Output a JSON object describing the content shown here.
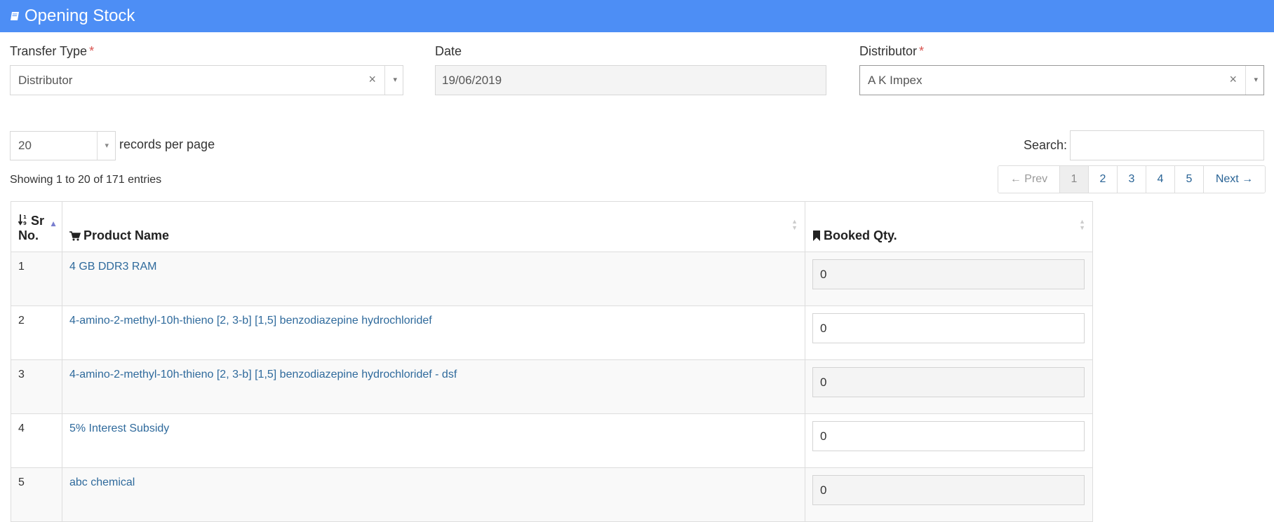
{
  "header": {
    "title": "Opening Stock",
    "icon": "book-icon"
  },
  "form": {
    "transfer_type": {
      "label": "Transfer Type",
      "required_mark": "*",
      "value": "Distributor",
      "clear_glyph": "×",
      "caret_glyph": "▾"
    },
    "date": {
      "label": "Date",
      "value": "19/06/2019"
    },
    "distributor": {
      "label": "Distributor",
      "required_mark": "*",
      "value": "A K Impex",
      "clear_glyph": "×",
      "caret_glyph": "▾"
    }
  },
  "table_controls": {
    "page_length": "20",
    "page_length_caret": "▾",
    "records_per_page_label": "records per page",
    "search_label": "Search:",
    "search_value": "",
    "info": "Showing 1 to 20 of 171 entries",
    "pagination": {
      "prev": "← Prev",
      "pages": [
        "1",
        "2",
        "3",
        "4",
        "5"
      ],
      "next": "Next →"
    }
  },
  "table": {
    "headers": {
      "sr_no": "Sr No.",
      "product_name": "Product Name",
      "booked_qty": "Booked Qty."
    },
    "rows": [
      {
        "sr": "1",
        "product": "4 GB DDR3 RAM",
        "qty": "0"
      },
      {
        "sr": "2",
        "product": "4-amino-2-methyl-10h-thieno [2, 3-b] [1,5] benzodiazepine hydrochloridef",
        "qty": "0"
      },
      {
        "sr": "3",
        "product": "4-amino-2-methyl-10h-thieno [2, 3-b] [1,5] benzodiazepine hydrochloridef - dsf",
        "qty": "0"
      },
      {
        "sr": "4",
        "product": "5% Interest Subsidy",
        "qty": "0"
      },
      {
        "sr": "5",
        "product": "abc chemical",
        "qty": "0"
      }
    ]
  },
  "colors": {
    "header_bg": "#4d8ef5",
    "link": "#2f6a9c",
    "required": "#d9534f"
  }
}
